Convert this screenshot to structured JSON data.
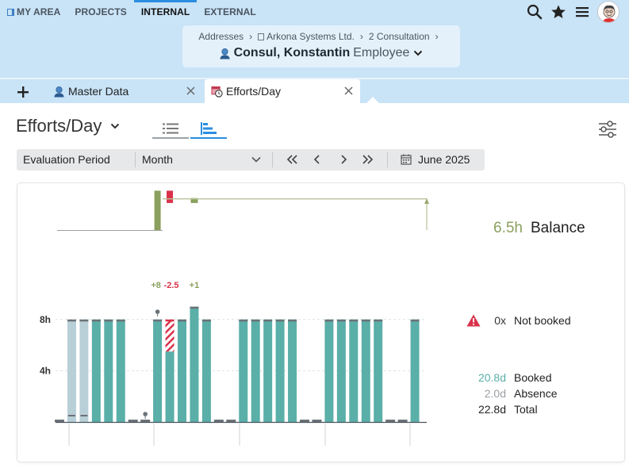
{
  "nav": {
    "items": [
      {
        "label": "MY AREA",
        "active": false
      },
      {
        "label": "PROJECTS",
        "active": false
      },
      {
        "label": "INTERNAL",
        "active": true
      },
      {
        "label": "EXTERNAL",
        "active": false
      }
    ],
    "icons": [
      "search-icon",
      "star-icon",
      "menu-icon",
      "avatar"
    ]
  },
  "context": {
    "breadcrumbs": [
      "Addresses",
      "Arkona Systems Ltd.",
      "2 Consultation"
    ],
    "person_name": "Consul, Konstantin",
    "person_role": "Employee"
  },
  "tabs": [
    {
      "label": "Master Data",
      "active": false
    },
    {
      "label": "Efforts/Day",
      "active": true
    }
  ],
  "page": {
    "title": "Efforts/Day",
    "view_modes": [
      "list-view",
      "chart-view"
    ],
    "active_view": "chart-view"
  },
  "filter": {
    "label": "Evaluation Period",
    "period": "Month",
    "date": "June 2025"
  },
  "stats": {
    "balance_value": "6.5h",
    "balance_label": "Balance",
    "not_booked_value": "0x",
    "not_booked_label": "Not booked",
    "booked_value": "20.8d",
    "booked_label": "Booked",
    "absence_value": "2.0d",
    "absence_label": "Absence",
    "total_value": "22.8d",
    "total_label": "Total"
  },
  "colors": {
    "booked": "#5aafa8",
    "absence": "#b9cfd8",
    "overtime_positive": "#8ba05e",
    "overtime_negative": "#d9324a",
    "booked_text": "#5aafa8",
    "absence_text": "#9aa0a6"
  },
  "chart_data": {
    "type": "bar",
    "y_unit": "h",
    "y_ticks": [
      "4h",
      "8h"
    ],
    "ylim": [
      0,
      8.5
    ],
    "target_hours": 8,
    "days": [
      {
        "day": 1,
        "booked": 0,
        "absence": 0,
        "over": 0
      },
      {
        "day": 2,
        "booked": 0,
        "absence": 8,
        "over": 0
      },
      {
        "day": 3,
        "booked": 0,
        "absence": 8,
        "over": 0
      },
      {
        "day": 4,
        "booked": 8,
        "absence": 0,
        "over": 0
      },
      {
        "day": 5,
        "booked": 8,
        "absence": 0,
        "over": 0
      },
      {
        "day": 6,
        "booked": 8,
        "absence": 0,
        "over": 0
      },
      {
        "day": 7,
        "booked": 0,
        "absence": 0,
        "over": 0
      },
      {
        "day": 8,
        "booked": 0,
        "absence": 0,
        "over": 0
      },
      {
        "day": 9,
        "booked": 8,
        "absence": 0,
        "over": 8,
        "label": "+8"
      },
      {
        "day": 10,
        "booked": 5.5,
        "absence": 0,
        "over": -2.5,
        "label": "-2.5"
      },
      {
        "day": 11,
        "booked": 8,
        "absence": 0,
        "over": 0
      },
      {
        "day": 12,
        "booked": 9,
        "absence": 0,
        "over": 1,
        "label": "+1"
      },
      {
        "day": 13,
        "booked": 8,
        "absence": 0,
        "over": 0
      },
      {
        "day": 14,
        "booked": 0,
        "absence": 0,
        "over": 0
      },
      {
        "day": 15,
        "booked": 0,
        "absence": 0,
        "over": 0
      },
      {
        "day": 16,
        "booked": 8,
        "absence": 0,
        "over": 0
      },
      {
        "day": 17,
        "booked": 8,
        "absence": 0,
        "over": 0
      },
      {
        "day": 18,
        "booked": 8,
        "absence": 0,
        "over": 0
      },
      {
        "day": 19,
        "booked": 8,
        "absence": 0,
        "over": 0
      },
      {
        "day": 20,
        "booked": 8,
        "absence": 0,
        "over": 0
      },
      {
        "day": 21,
        "booked": 0,
        "absence": 0,
        "over": 0
      },
      {
        "day": 22,
        "booked": 0,
        "absence": 0,
        "over": 0
      },
      {
        "day": 23,
        "booked": 8,
        "absence": 0,
        "over": 0
      },
      {
        "day": 24,
        "booked": 8,
        "absence": 0,
        "over": 0
      },
      {
        "day": 25,
        "booked": 8,
        "absence": 0,
        "over": 0
      },
      {
        "day": 26,
        "booked": 8,
        "absence": 0,
        "over": 0
      },
      {
        "day": 27,
        "booked": 8,
        "absence": 0,
        "over": 0
      },
      {
        "day": 28,
        "booked": 0,
        "absence": 0,
        "over": 0
      },
      {
        "day": 29,
        "booked": 0,
        "absence": 0,
        "over": 0
      },
      {
        "day": 30,
        "booked": 8,
        "absence": 0,
        "over": 0
      }
    ],
    "balance_running": [
      0,
      0,
      0,
      0,
      0,
      0,
      0,
      0,
      8,
      5.5,
      5.5,
      6.5,
      6.5,
      6.5,
      6.5,
      6.5,
      6.5,
      6.5,
      6.5,
      6.5,
      6.5,
      6.5,
      6.5,
      6.5,
      6.5,
      6.5,
      6.5,
      6.5,
      6.5,
      6.5
    ]
  }
}
